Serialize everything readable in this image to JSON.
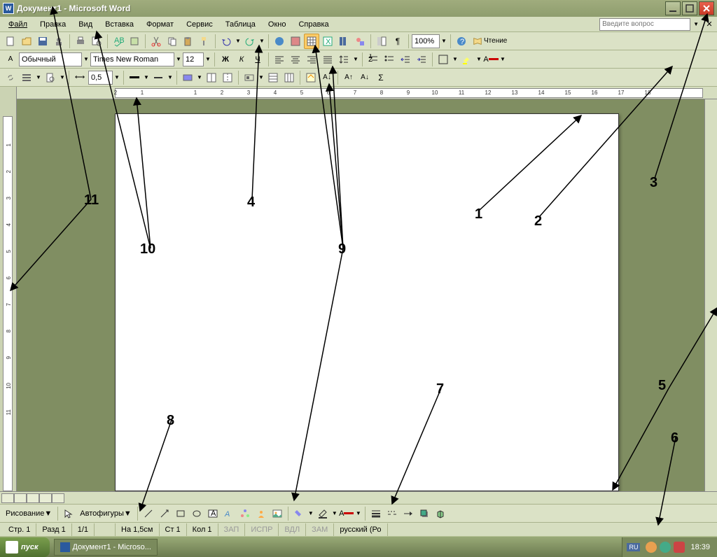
{
  "window": {
    "title": "Документ1 - Microsoft Word",
    "app_icon_text": "W"
  },
  "menu": {
    "file": "Файл",
    "edit": "Правка",
    "view": "Вид",
    "insert": "Вставка",
    "format": "Формат",
    "service": "Сервис",
    "table": "Таблица",
    "window": "Окно",
    "help": "Справка",
    "question_placeholder": "Введите вопрос"
  },
  "toolbar1": {
    "zoom": "100%",
    "reading": "Чтение"
  },
  "toolbar2": {
    "style": "Обычный",
    "font": "Times New Roman",
    "size": "12",
    "bold": "Ж",
    "italic": "К",
    "underline": "Ч"
  },
  "toolbar3": {
    "spacing": "0,5"
  },
  "drawing": {
    "label": "Рисование",
    "autoshapes": "Автофигуры"
  },
  "status": {
    "page": "Стр. 1",
    "section": "Разд 1",
    "pages": "1/1",
    "position": "На 1,5см",
    "line": "Ст 1",
    "col": "Кол 1",
    "zap": "ЗАП",
    "ispr": "ИСПР",
    "vdl": "ВДЛ",
    "zam": "ЗАМ",
    "lang": "русский (Ро"
  },
  "taskbar": {
    "start": "пуск",
    "task": "Документ1 - Microso...",
    "lang": "RU",
    "time": "18:39"
  },
  "annotations": {
    "n1": "1",
    "n2": "2",
    "n3": "3",
    "n4": "4",
    "n5": "5",
    "n6": "6",
    "n7": "7",
    "n8": "8",
    "n9": "9",
    "n10": "10",
    "n11": "11"
  },
  "ruler": {
    "h_ticks": [
      "2",
      "1",
      "",
      "1",
      "2",
      "3",
      "4",
      "5",
      "6",
      "7",
      "8",
      "9",
      "10",
      "11",
      "12",
      "13",
      "14",
      "15",
      "16",
      "17",
      "18"
    ],
    "v_ticks": [
      "",
      "1",
      "2",
      "3",
      "4",
      "5",
      "6",
      "7",
      "8",
      "9",
      "10",
      "11"
    ]
  }
}
